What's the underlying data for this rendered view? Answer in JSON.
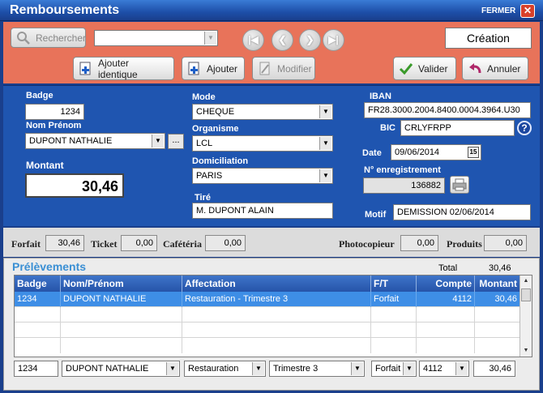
{
  "window": {
    "title": "Remboursements",
    "close_label": "FERMER",
    "close_glyph": "✕"
  },
  "toolbar": {
    "search_label": "Rechercher",
    "search_combo_value": "",
    "nav": {
      "first": "|◀",
      "prev": "❮",
      "next": "❯",
      "last": "▶|"
    },
    "mode_label": "Création",
    "add_identical_label": "Ajouter identique",
    "add_label": "Ajouter",
    "modify_label": "Modifier",
    "validate_label": "Valider",
    "cancel_label": "Annuler"
  },
  "form": {
    "badge": {
      "label": "Badge",
      "value": "1234"
    },
    "nom": {
      "label": "Nom Prénom",
      "value": "DUPONT NATHALIE",
      "more": "..."
    },
    "montant": {
      "label": "Montant",
      "value": "30,46"
    },
    "mode": {
      "label": "Mode",
      "value": "CHEQUE"
    },
    "organisme": {
      "label": "Organisme",
      "value": "LCL"
    },
    "domiciliation": {
      "label": "Domiciliation",
      "value": "PARIS"
    },
    "tire": {
      "label": "Tiré",
      "value": "M. DUPONT ALAIN"
    },
    "iban": {
      "label": "IBAN",
      "value": "FR28.3000.2004.8400.0004.3964.U30"
    },
    "bic": {
      "label": "BIC",
      "value": "CRLYFRPP",
      "help": "?"
    },
    "date": {
      "label": "Date",
      "value": "09/06/2014",
      "cal": "15"
    },
    "enregistrement": {
      "label": "N° enregistrement",
      "value": "136882"
    },
    "motif": {
      "label": "Motif",
      "value": "DEMISSION 02/06/2014"
    }
  },
  "totals": {
    "forfait": {
      "label": "Forfait",
      "value": "30,46"
    },
    "ticket": {
      "label": "Ticket",
      "value": "0,00"
    },
    "cafeteria": {
      "label": "Cafétéria",
      "value": "0,00"
    },
    "photocopieur": {
      "label": "Photocopieur",
      "value": "0,00"
    },
    "produits": {
      "label": "Produits",
      "value": "0,00"
    }
  },
  "prelevements": {
    "title": "Prélèvements",
    "total_label": "Total",
    "total_value": "30,46",
    "columns": [
      "Badge",
      "Nom/Prénom",
      "Affectation",
      "F/T",
      "Compte",
      "Montant"
    ],
    "rows": [
      [
        "1234",
        "DUPONT NATHALIE",
        "Restauration - Trimestre 3",
        "Forfait",
        "4112",
        "30,46"
      ]
    ],
    "editor": {
      "badge": "1234",
      "nom": "DUPONT NATHALIE",
      "affectation": "Restauration",
      "trimestre": "Trimestre 3",
      "ft": "Forfait",
      "compte": "4112",
      "montant": "30,46"
    }
  },
  "colors": {
    "toolbar": "#e8735a",
    "form": "#1f55b0",
    "header": "#2f63bd",
    "selected_row": "#3e8ee6"
  }
}
